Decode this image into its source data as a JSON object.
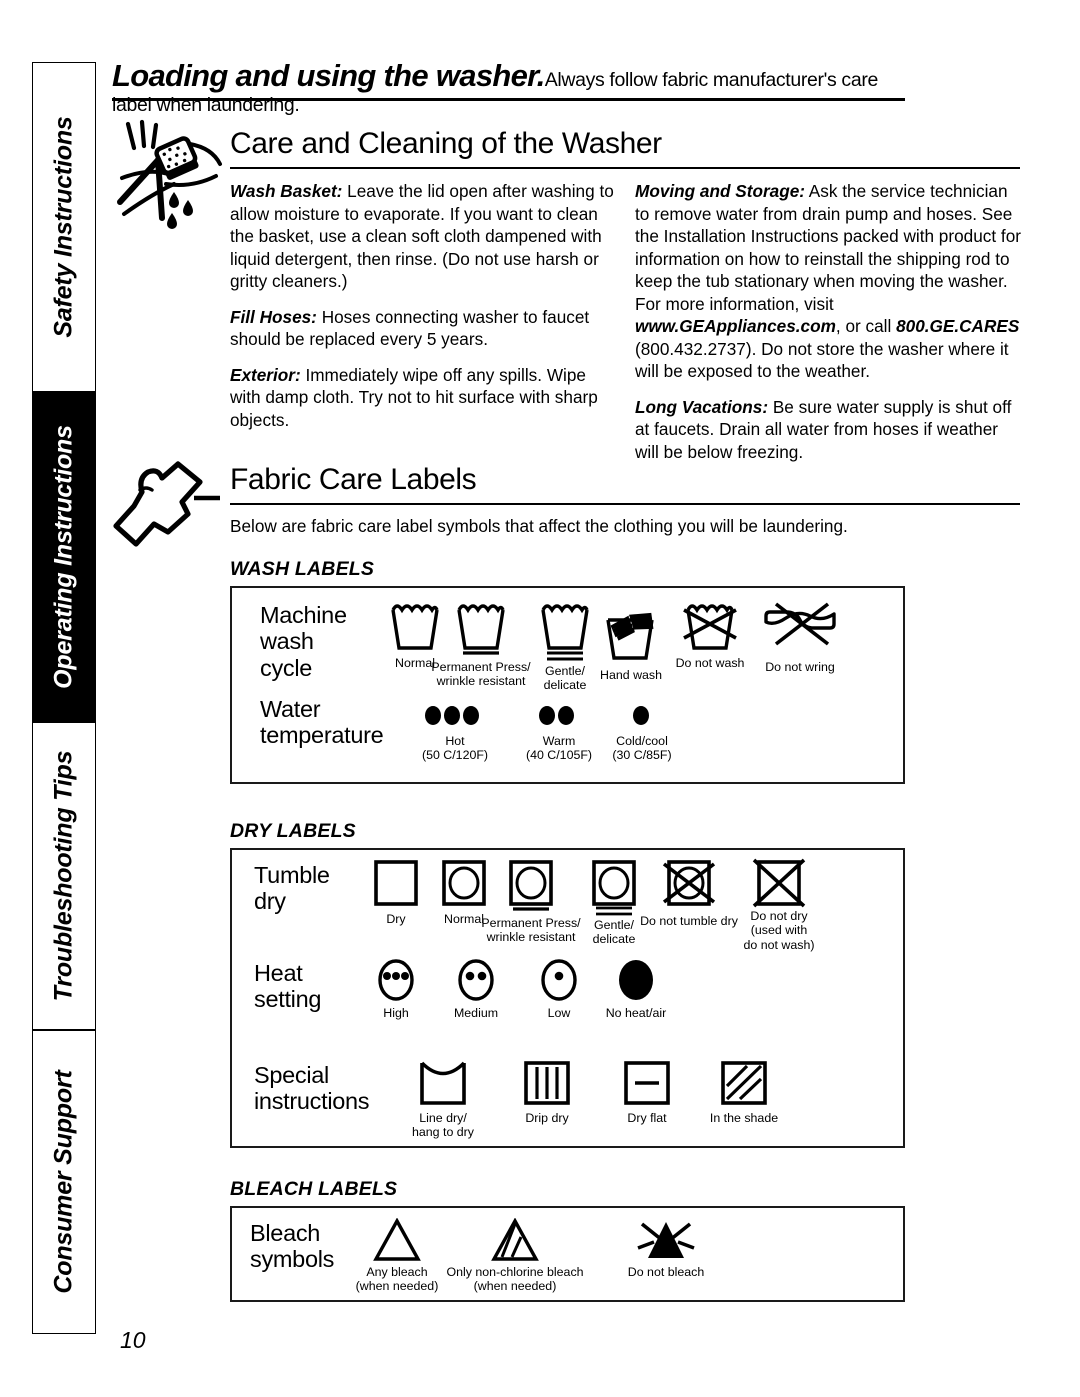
{
  "page": {
    "folio": "10"
  },
  "sidebar": {
    "tabs": [
      {
        "label": "Safety Instructions",
        "active": false
      },
      {
        "label": "Operating Instructions",
        "active": true
      },
      {
        "label": "Troubleshooting Tips",
        "active": false
      },
      {
        "label": "Consumer Support",
        "active": false
      }
    ]
  },
  "running_head": {
    "title": "Loading and using the washer.",
    "subtitle": "Always follow fabric manufacturer's care label when laundering."
  },
  "sections": [
    {
      "id": "care-and-cleaning",
      "title": "Care and Cleaning of the Washer",
      "icon": "sponge-cleaning-icon",
      "left_column": [
        {
          "lead": "Wash Basket:",
          "body": " Leave the lid open after washing to allow moisture to evaporate. If you want to clean the basket, use a clean soft cloth dampened with liquid detergent, then rinse. (Do not use harsh or gritty cleaners.)"
        },
        {
          "lead": "Fill Hoses:",
          "body": " Hoses connecting washer to faucet should be replaced every 5 years."
        },
        {
          "lead": "Exterior:",
          "body": " Immediately wipe off any spills. Wipe with damp cloth. Try not to hit surface with sharp objects."
        }
      ],
      "right_column": [
        {
          "lead": "Moving and Storage:",
          "body": " Ask the service technician to remove water from drain pump and hoses.  See the Installation Instructions packed with product for information on how to reinstall the shipping rod to keep the tub stationary when moving the washer. For more information, visit ",
          "bold_1": "www.GEAppliances.com",
          "mid": ", or call ",
          "bold_2": "800.GE.CARES",
          "tail": " (800.432.2737). Do not store the washer where it will be exposed to the weather."
        },
        {
          "lead": "Long Vacations:",
          "body": " Be sure water supply is shut off at faucets. Drain all water from hoses if weather will be below freezing."
        }
      ]
    },
    {
      "id": "fabric-care-labels",
      "title": "Fabric Care Labels",
      "icon": "garment-shirt-icon",
      "intro": "Below are fabric care label  symbols  that affect the clothing you will be laundering."
    }
  ],
  "label_groups": [
    {
      "id": "wash-labels",
      "caption": "WASH LABELS",
      "rows": [
        {
          "id": "machine-wash-cycle",
          "label": "Machine\nwash\ncycle",
          "label_lines": [
            "Machine",
            "wash",
            "cycle"
          ],
          "symbols": [
            {
              "name": "wash-basin-icon",
              "caption": [
                "Normal"
              ]
            },
            {
              "name": "wash-basin-one-bar-icon",
              "caption": [
                "Permanent Press/",
                "wrinkle resistant"
              ]
            },
            {
              "name": "wash-basin-two-bar-icon",
              "caption": [
                "Gentle/",
                "delicate"
              ]
            },
            {
              "name": "hand-wash-icon",
              "caption": [
                "Hand wash"
              ]
            },
            {
              "name": "do-not-wash-icon",
              "caption": [
                "Do not wash"
              ]
            },
            {
              "name": "do-not-wring-icon",
              "caption": [
                "Do not wring"
              ]
            }
          ]
        },
        {
          "id": "water-temperature",
          "label_lines": [
            "Water",
            "temperature"
          ],
          "symbols": [
            {
              "name": "three-dots-icon",
              "dots": 3,
              "caption": [
                "Hot",
                "(50 C/120F)"
              ]
            },
            {
              "name": "two-dots-icon",
              "dots": 2,
              "caption": [
                "Warm",
                "(40 C/105F)"
              ]
            },
            {
              "name": "one-dot-icon",
              "dots": 1,
              "caption": [
                "Cold/cool",
                "(30 C/85F)"
              ]
            }
          ]
        }
      ]
    },
    {
      "id": "dry-labels",
      "caption": "DRY LABELS",
      "rows": [
        {
          "id": "tumble-dry",
          "label_lines": [
            "Tumble",
            "dry"
          ],
          "symbols": [
            {
              "name": "dry-square-icon",
              "caption": [
                "Dry"
              ]
            },
            {
              "name": "tumble-dry-normal-icon",
              "caption": [
                "Normal"
              ]
            },
            {
              "name": "tumble-dry-one-bar-icon",
              "caption": [
                "Permanent Press/",
                "wrinkle resistant"
              ]
            },
            {
              "name": "tumble-dry-two-bar-icon",
              "caption": [
                "Gentle/",
                "delicate"
              ]
            },
            {
              "name": "do-not-tumble-dry-icon",
              "caption": [
                "Do not tumble dry"
              ]
            },
            {
              "name": "do-not-dry-icon",
              "caption": [
                "Do not dry",
                "(used with",
                "do not wash)"
              ]
            }
          ]
        },
        {
          "id": "heat-setting",
          "label_lines": [
            "Heat",
            "setting"
          ],
          "symbols": [
            {
              "name": "heat-high-icon",
              "caption": [
                "High"
              ]
            },
            {
              "name": "heat-medium-icon",
              "caption": [
                "Medium"
              ]
            },
            {
              "name": "heat-low-icon",
              "caption": [
                "Low"
              ]
            },
            {
              "name": "no-heat-air-icon",
              "caption": [
                "No heat/air"
              ]
            }
          ]
        },
        {
          "id": "special-instructions",
          "label_lines": [
            "Special",
            "instructions"
          ],
          "symbols": [
            {
              "name": "line-dry-icon",
              "caption": [
                "Line dry/",
                "hang to dry"
              ]
            },
            {
              "name": "drip-dry-icon",
              "caption": [
                "Drip dry"
              ]
            },
            {
              "name": "dry-flat-icon",
              "caption": [
                "Dry flat"
              ]
            },
            {
              "name": "in-the-shade-icon",
              "caption": [
                "In the shade"
              ]
            }
          ]
        }
      ]
    },
    {
      "id": "bleach-labels",
      "caption": "BLEACH LABELS",
      "rows": [
        {
          "id": "bleach-symbols",
          "label_lines": [
            "Bleach",
            "symbols"
          ],
          "symbols": [
            {
              "name": "any-bleach-icon",
              "caption": [
                "Any bleach",
                "(when needed)"
              ]
            },
            {
              "name": "non-chlorine-bleach-icon",
              "caption": [
                "Only non-chlorine bleach",
                "(when needed)"
              ]
            },
            {
              "name": "do-not-bleach-icon",
              "caption": [
                "Do not bleach"
              ]
            }
          ]
        }
      ]
    }
  ],
  "colors": {
    "ink": "#000000",
    "panel_border": "#1a1a1a",
    "page": "#ffffff"
  }
}
